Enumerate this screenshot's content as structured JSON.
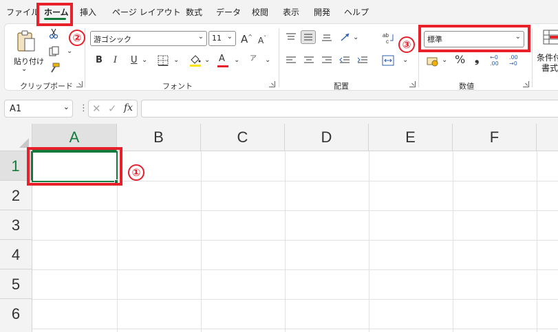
{
  "menu": {
    "tabs": [
      {
        "label": "ファイル"
      },
      {
        "label": "ホーム"
      },
      {
        "label": "挿入"
      },
      {
        "label": "ページ レイアウト"
      },
      {
        "label": "数式"
      },
      {
        "label": "データ"
      },
      {
        "label": "校閲"
      },
      {
        "label": "表示"
      },
      {
        "label": "開発"
      },
      {
        "label": "ヘルプ"
      }
    ],
    "active_tab": "ホーム"
  },
  "ribbon": {
    "clipboard": {
      "paste_label": "貼り付け",
      "group_label": "クリップボード"
    },
    "font": {
      "font_name": "游ゴシック",
      "font_size": "11",
      "group_label": "フォント",
      "bold": "B",
      "italic": "I",
      "underline": "U",
      "grow": "A",
      "shrink": "A",
      "font_color_letter": "A",
      "phonetic": "ア"
    },
    "alignment": {
      "group_label": "配置"
    },
    "number": {
      "format_value": "標準",
      "group_label": "数値",
      "percent": "%",
      "comma": "❟",
      "increase_decimal": ".00",
      "decrease_decimal": ".00"
    },
    "styles": {
      "conditional_label_line1": "条件付",
      "conditional_label_line2": "書式"
    }
  },
  "formula_bar": {
    "name_box": "A1",
    "fx": "fx",
    "formula": ""
  },
  "sheet": {
    "columns": [
      "A",
      "B",
      "C",
      "D",
      "E",
      "F"
    ],
    "rows": [
      "1",
      "2",
      "3",
      "4",
      "5",
      "6"
    ],
    "active_cell": "A1"
  },
  "annotations": {
    "marker1": "①",
    "marker2": "②",
    "marker3": "③"
  },
  "colors": {
    "accent": "#137a3c",
    "annotation": "#e8202a"
  }
}
